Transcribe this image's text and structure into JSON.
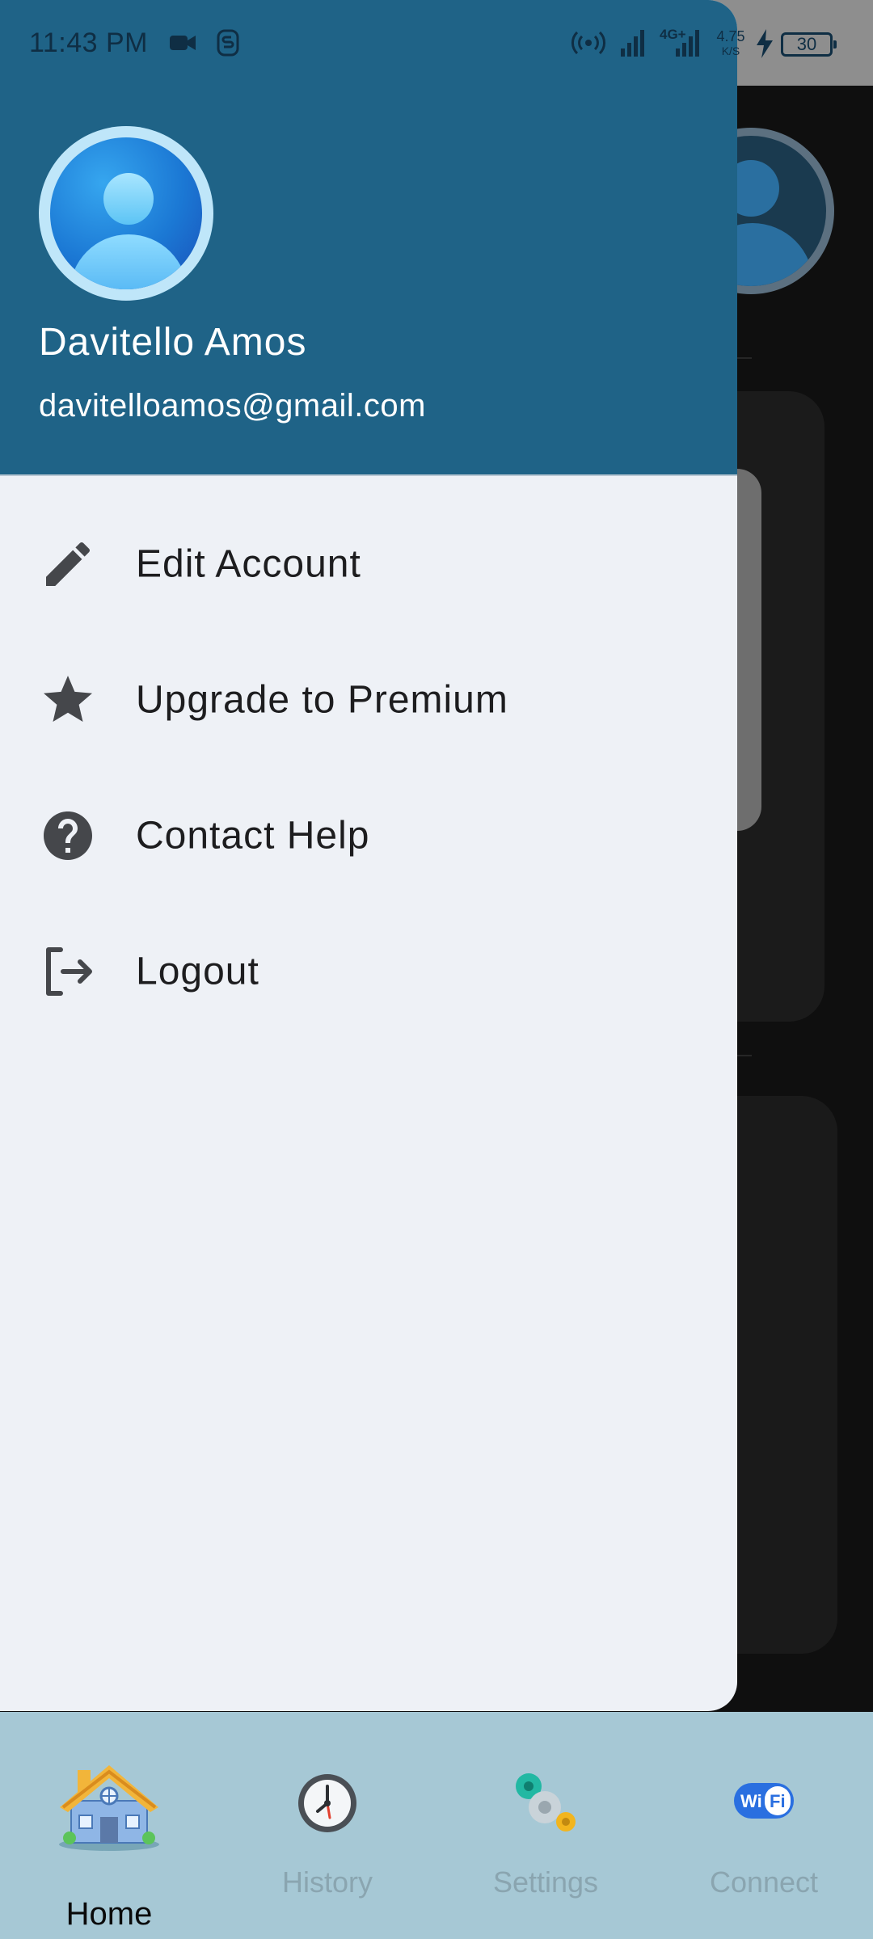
{
  "status_bar": {
    "time": "11:43 PM",
    "network_type": "4G+",
    "network_speed": "4.75",
    "network_speed_unit": "K/S",
    "battery_level": "30",
    "icons": [
      "video-camera-icon",
      "s-notification-icon",
      "hotspot-icon",
      "signal-icon",
      "signal-icon",
      "charging-bolt-icon",
      "battery-icon"
    ]
  },
  "profile": {
    "name": "Davitello Amos",
    "email": "davitelloamos@gmail.com",
    "avatar_icon": "user-avatar-icon"
  },
  "menu": {
    "items": [
      {
        "label": "Edit Account",
        "icon": "pencil-icon"
      },
      {
        "label": "Upgrade to Premium",
        "icon": "star-icon"
      },
      {
        "label": "Contact Help",
        "icon": "help-circle-icon"
      },
      {
        "label": "Logout",
        "icon": "logout-icon"
      }
    ]
  },
  "bottom_nav": {
    "items": [
      {
        "label": "Home",
        "icon": "house-icon",
        "active": true
      },
      {
        "label": "History",
        "icon": "clock-icon",
        "active": false
      },
      {
        "label": "Settings",
        "icon": "gears-icon",
        "active": false
      },
      {
        "label": "Connect",
        "icon": "wifi-icon",
        "active": false
      }
    ]
  },
  "colors": {
    "drawer_header": "#1f6387",
    "drawer_body": "#eef1f6",
    "bottom_nav_bg": "#a6c8d5",
    "nav_inactive_text": "#8aa5b0"
  }
}
